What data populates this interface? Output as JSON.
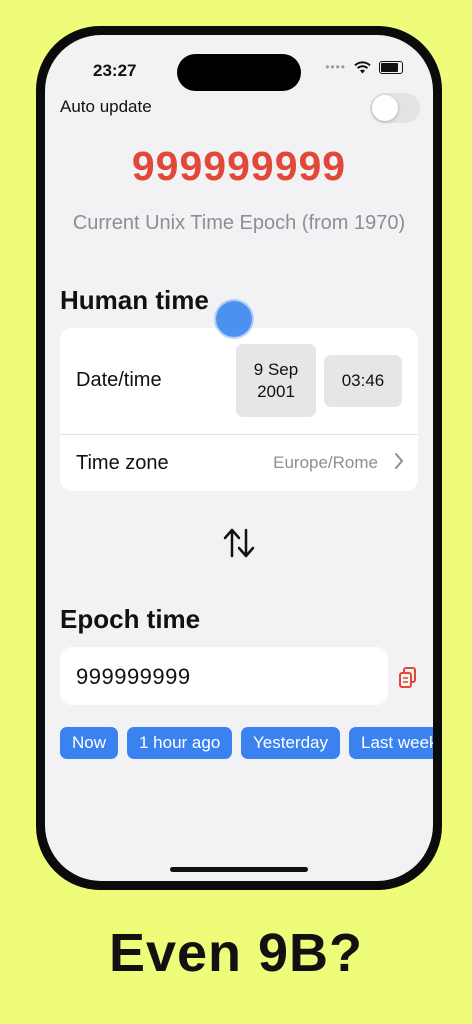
{
  "status_bar": {
    "time": "23:27"
  },
  "auto_update": {
    "label": "Auto update",
    "enabled": false
  },
  "current_epoch": {
    "value": "999999999",
    "caption": "Current Unix Time Epoch (from 1970)"
  },
  "human_time": {
    "title": "Human time",
    "date_label": "Date/time",
    "date_line1": "9 Sep",
    "date_line2": "2001",
    "time_value": "03:46",
    "timezone_label": "Time zone",
    "timezone_value": "Europe/Rome"
  },
  "epoch_time": {
    "title": "Epoch time",
    "value": "999999999"
  },
  "quick_buttons": [
    "Now",
    "1 hour ago",
    "Yesterday",
    "Last week"
  ],
  "colors": {
    "background": "#eefc7a",
    "accent": "#3a82f0",
    "epoch_red": "#e2483a"
  },
  "icons": [
    "wifi-icon",
    "battery-icon",
    "chevron-right-icon",
    "swap-arrows-icon",
    "copy-icon"
  ],
  "caption": "Even 9B?"
}
